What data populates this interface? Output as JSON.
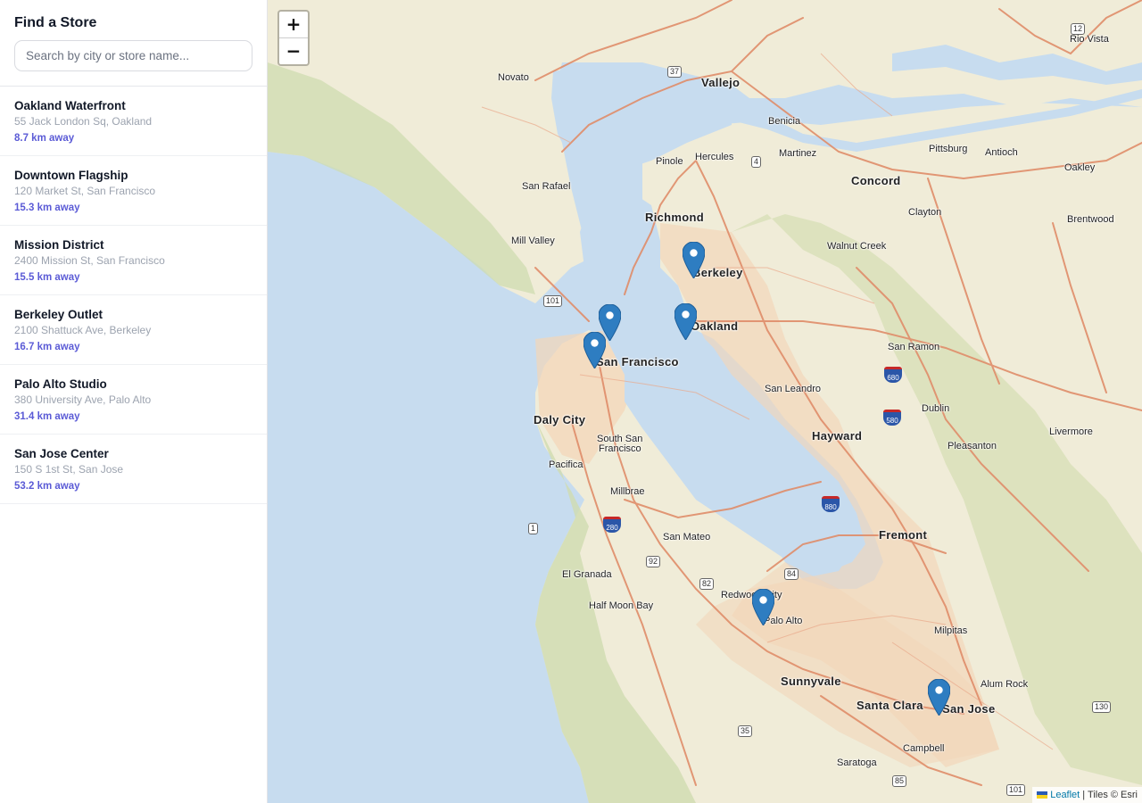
{
  "sidebar": {
    "title": "Find a Store",
    "search_placeholder": "Search by city or store name...",
    "stores": [
      {
        "name": "Oakland Waterfront",
        "address": "55 Jack London Sq, Oakland",
        "distance": "8.7 km away"
      },
      {
        "name": "Downtown Flagship",
        "address": "120 Market St, San Francisco",
        "distance": "15.3 km away"
      },
      {
        "name": "Mission District",
        "address": "2400 Mission St, San Francisco",
        "distance": "15.5 km away"
      },
      {
        "name": "Berkeley Outlet",
        "address": "2100 Shattuck Ave, Berkeley",
        "distance": "16.7 km away"
      },
      {
        "name": "Palo Alto Studio",
        "address": "380 University Ave, Palo Alto",
        "distance": "31.4 km away"
      },
      {
        "name": "San Jose Center",
        "address": "150 S 1st St, San Jose",
        "distance": "53.2 km away"
      }
    ]
  },
  "map": {
    "zoom_in": "+",
    "zoom_out": "−",
    "attribution_link": "Leaflet",
    "attribution_text": "| Tiles © Esri",
    "marker_color": "#2e7dc1",
    "water_color": "#c7dcef",
    "land_color": "#f0ecd8",
    "cities": {
      "novato": "Novato",
      "vallejo": "Vallejo",
      "benicia": "Benicia",
      "rio_vista": "Rio Vista",
      "pinole": "Pinole",
      "hercules": "Hercules",
      "martinez": "Martinez",
      "pittsburg": "Pittsburg",
      "antioch": "Antioch",
      "oakley": "Oakley",
      "san_rafael": "San Rafael",
      "concord": "Concord",
      "richmond": "Richmond",
      "clayton": "Clayton",
      "brentwood": "Brentwood",
      "mill_valley": "Mill Valley",
      "walnut_creek": "Walnut Creek",
      "berkeley": "Berkeley",
      "oakland": "Oakland",
      "san_francisco": "San Francisco",
      "san_ramon": "San Ramon",
      "san_leandro": "San Leandro",
      "dublin": "Dublin",
      "daly_city": "Daly City",
      "hayward": "Hayward",
      "livermore": "Livermore",
      "south_sf_1": "South San",
      "south_sf_2": "Francisco",
      "pleasanton": "Pleasanton",
      "pacifica": "Pacifica",
      "millbrae": "Millbrae",
      "fremont": "Fremont",
      "san_mateo": "San Mateo",
      "el_granada": "El Granada",
      "redwood_city": "Redwood City",
      "half_moon_bay": "Half Moon Bay",
      "palo_alto": "Palo Alto",
      "milpitas": "Milpitas",
      "sunnyvale": "Sunnyvale",
      "alum_rock": "Alum Rock",
      "santa_clara": "Santa Clara",
      "san_jose": "San Jose",
      "campbell": "Campbell",
      "saratoga": "Saratoga"
    },
    "shields": {
      "r12": "12",
      "r37": "37",
      "r4": "4",
      "r101a": "101",
      "r1": "1",
      "r92": "92",
      "r82": "82",
      "r84": "84",
      "r35": "35",
      "r85": "85",
      "r101b": "101",
      "r130": "130",
      "i680a": "680",
      "i580": "580",
      "i880": "880",
      "i280": "280"
    }
  }
}
